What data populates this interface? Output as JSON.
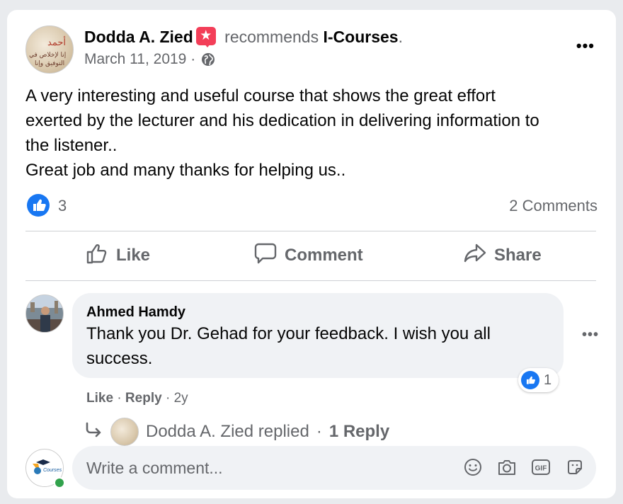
{
  "post": {
    "author": "Dodda A. Zied",
    "verb": "recommends",
    "page_name": "I-Courses",
    "page_suffix": ".",
    "date": "March 11, 2019",
    "date_separator": "·",
    "text_lines": [
      "A very interesting and useful course that shows the great effort",
      "exerted by the lecturer and his dedication in delivering information to",
      "the listener..",
      "Great job and many thanks for helping us.."
    ],
    "more_label": "•••",
    "avatar_script": [
      "أحمد",
      "إنا لإخلاص في",
      "التوفيق وإنا"
    ]
  },
  "reactions": {
    "like_count": "3",
    "comments_count": "2 Comments"
  },
  "actions": {
    "like": "Like",
    "comment": "Comment",
    "share": "Share"
  },
  "comment": {
    "name": "Ahmed Hamdy",
    "text_lines": [
      "Thank you Dr. Gehad for your feedback. I wish you all",
      "success."
    ],
    "reaction_count": "1",
    "like_label": "Like",
    "reply_label": "Reply",
    "age": "2y",
    "sep": "·",
    "more_label": "•••"
  },
  "replies": {
    "text": "Dodda A. Zied replied",
    "sep": "·",
    "count_label": "1 Reply"
  },
  "composer": {
    "placeholder": "Write a comment...",
    "avatar_label": "Courses"
  },
  "icons": {
    "badge": "star-badge-icon",
    "privacy": "globe-icon",
    "like_reaction": "thumbs-up-icon",
    "reply_arrow": "reply-arrow-icon",
    "emoji": "emoji-icon",
    "camera": "camera-icon",
    "gif": "gif-icon",
    "sticker": "sticker-icon"
  },
  "colors": {
    "accent": "#1877f2",
    "badge": "#f33e58",
    "muted_text": "#65676b",
    "online": "#31a24c"
  }
}
